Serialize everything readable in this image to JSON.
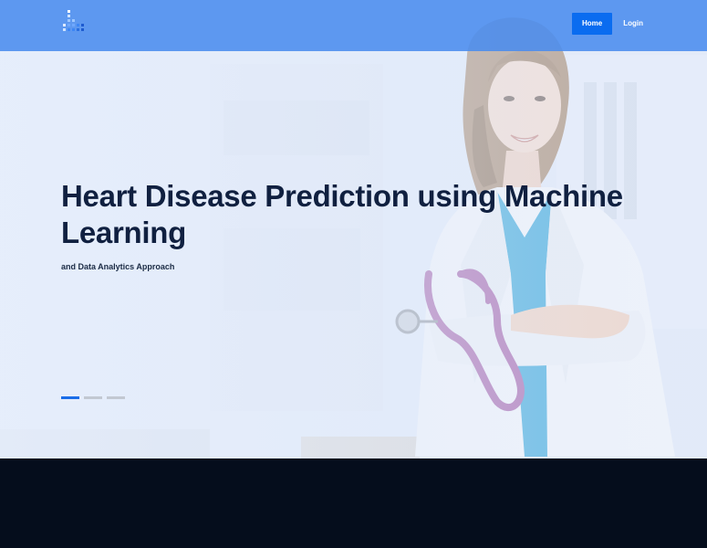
{
  "header": {
    "logo_icon": "pixel-plus-logo-icon",
    "nav": [
      {
        "label": "Home",
        "active": true
      },
      {
        "label": "Login",
        "active": false
      }
    ]
  },
  "hero": {
    "title": "Heart Disease Prediction using Machine Learning",
    "subtitle": "and Data Analytics Approach",
    "background_icon": "smiling-doctor-with-stethoscope-photo",
    "slides_total": 3,
    "active_slide": 1
  },
  "colors": {
    "header_bg": "#4a8cee",
    "nav_active_bg": "#0a6cf0",
    "title_text": "#102040",
    "indicator_active": "#1a6de8",
    "indicator_inactive": "#c2c8d2",
    "footer_bg": "#050d1c"
  }
}
